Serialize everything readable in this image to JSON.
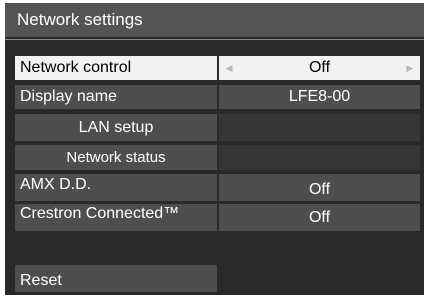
{
  "title": "Network settings",
  "rows": [
    {
      "label": "Network control",
      "value": "Off"
    },
    {
      "label": "Display name",
      "value": "LFE8-00"
    },
    {
      "label": "LAN setup"
    },
    {
      "label": "Network status"
    },
    {
      "label": "AMX D.D.",
      "value": "Off"
    },
    {
      "label": "Crestron Connected™",
      "value": "Off"
    },
    {
      "label": "Reset"
    }
  ],
  "icons": {
    "left_arrow": "◀",
    "right_arrow": "▶"
  },
  "colors": {
    "panel_background": "#292929",
    "title_bar": "#545454",
    "item_background": "#4e4e4e",
    "selected_background": "#f2f2f2"
  }
}
